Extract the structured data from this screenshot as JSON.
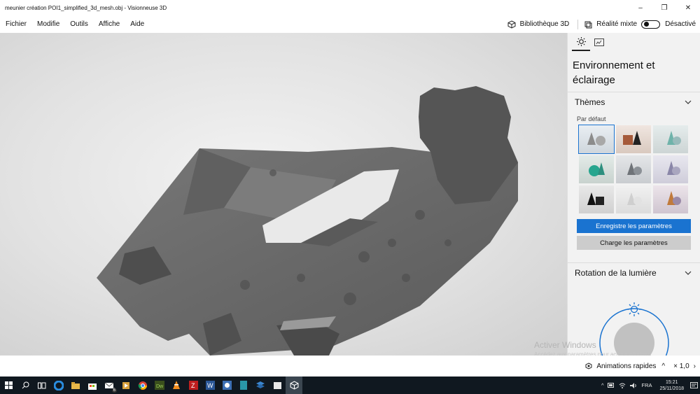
{
  "window": {
    "title": "meunier création POI1_simplified_3d_mesh.obj - Visionneuse 3D",
    "controls": [
      "–",
      "❐",
      "✕"
    ]
  },
  "menu": {
    "items": [
      "Fichier",
      "Modifie",
      "Outils",
      "Affiche",
      "Aide"
    ],
    "library_label": "Bibliothèque 3D",
    "mixed_reality_label": "Réalité mixte",
    "toggle_state": "Désactivé"
  },
  "panel": {
    "heading": "Environnement et éclairage",
    "themes_label": "Thèmes",
    "default_label": "Par défaut",
    "save_button": "Enregistre les paramètres",
    "load_button": "Charge les paramètres",
    "rotation_label": "Rotation de la lumière"
  },
  "status": {
    "animations_label": "Animations rapides",
    "animation_chevron": "^",
    "zoom": "× 1,0",
    "zoom_chevron": "›"
  },
  "watermark": {
    "line1": "Activer Windows",
    "line2": "Accédez aux paramètres pour activer Windows."
  },
  "taskbar": {
    "language": "FRA",
    "time": "15:21",
    "date": "25/11/2018",
    "mail_badge": "6"
  },
  "colors": {
    "accent": "#1a73d0",
    "taskbar": "#101820",
    "mesh": "#6e6e6e"
  }
}
